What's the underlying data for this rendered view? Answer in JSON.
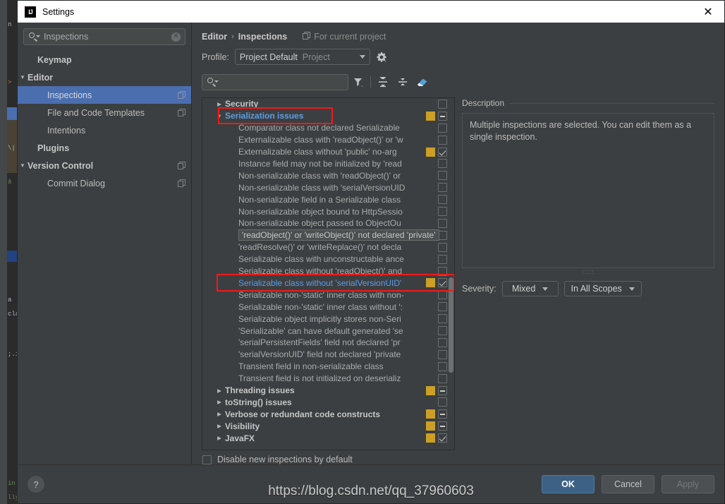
{
  "window": {
    "title": "Settings",
    "logo_text": "IJ",
    "close_icon": "close-icon"
  },
  "nav": {
    "search": {
      "value": "Inspections",
      "clear_icon": "clear-icon",
      "search_icon": "search-icon"
    },
    "items": [
      {
        "label": "Keymap",
        "bold": true,
        "arrow": "",
        "indent": 14,
        "selected": false,
        "copy": false
      },
      {
        "label": "Editor",
        "bold": true,
        "arrow": "▼",
        "indent": 0,
        "selected": false,
        "copy": false
      },
      {
        "label": "Inspections",
        "bold": false,
        "arrow": "",
        "indent": 28,
        "selected": true,
        "copy": true
      },
      {
        "label": "File and Code Templates",
        "bold": false,
        "arrow": "",
        "indent": 28,
        "selected": false,
        "copy": true
      },
      {
        "label": "Intentions",
        "bold": false,
        "arrow": "",
        "indent": 28,
        "selected": false,
        "copy": false
      },
      {
        "label": "Plugins",
        "bold": true,
        "arrow": "",
        "indent": 14,
        "selected": false,
        "copy": false
      },
      {
        "label": "Version Control",
        "bold": true,
        "arrow": "▼",
        "indent": 0,
        "selected": false,
        "copy": true
      },
      {
        "label": "Commit Dialog",
        "bold": false,
        "arrow": "",
        "indent": 28,
        "selected": false,
        "copy": true
      }
    ]
  },
  "header": {
    "breadcrumb_parent": "Editor",
    "breadcrumb_sep": "›",
    "breadcrumb_current": "Inspections",
    "for_current_project": "For current project",
    "profile_label": "Profile:",
    "profile_value": "Project Default",
    "profile_scope": "Project",
    "gear_icon": "gear-icon"
  },
  "toolbar": {
    "filter_placeholder": "",
    "filter_value": "",
    "filter_icon": "filter-funnel-icon",
    "expand_all_icon": "expand-all-icon",
    "collapse_all_icon": "collapse-all-icon",
    "reset_icon": "eraser-reset-icon"
  },
  "tree": {
    "rows": [
      {
        "label": "Security",
        "type": "group",
        "arrow": "▶",
        "sev": false,
        "check": "none"
      },
      {
        "label": "Serialization issues",
        "type": "group",
        "arrow": "▼",
        "sev": true,
        "check": "partial",
        "highlighted": true,
        "expanded_selected": true
      },
      {
        "label": "Comparator class not declared Serializable",
        "type": "leaf",
        "sev": false,
        "check": "none"
      },
      {
        "label": "Externalizable class with 'readObject()' or 'w",
        "type": "leaf",
        "sev": false,
        "check": "none"
      },
      {
        "label": "Externalizable class without 'public' no-arg ",
        "type": "leaf",
        "sev": true,
        "check": "checked"
      },
      {
        "label": "Instance field may not be initialized by 'read",
        "type": "leaf",
        "sev": false,
        "check": "none"
      },
      {
        "label": "Non-serializable class with 'readObject()' or ",
        "type": "leaf",
        "sev": false,
        "check": "none"
      },
      {
        "label": "Non-serializable class with 'serialVersionUID",
        "type": "leaf",
        "sev": false,
        "check": "none"
      },
      {
        "label": "Non-serializable field in a Serializable class",
        "type": "leaf",
        "sev": false,
        "check": "none"
      },
      {
        "label": "Non-serializable object bound to HttpSessio",
        "type": "leaf",
        "sev": false,
        "check": "none"
      },
      {
        "label": "Non-serializable object passed to ObjectOu",
        "type": "leaf",
        "sev": false,
        "check": "none"
      },
      {
        "label": "'readObject()' or 'writeObject()' not declared 'private'",
        "type": "leaf",
        "sev": false,
        "check": "none",
        "tooltip": true
      },
      {
        "label": "'readResolve()' or 'writeReplace()' not decla",
        "type": "leaf",
        "sev": false,
        "check": "none"
      },
      {
        "label": "Serializable class with unconstructable ance",
        "type": "leaf",
        "sev": false,
        "check": "none"
      },
      {
        "label": "Serializable class without 'readObject()' and ",
        "type": "leaf",
        "sev": false,
        "check": "none"
      },
      {
        "label": "Serializable class without 'serialVersionUID'",
        "type": "leaf",
        "sev": true,
        "check": "checked",
        "selected": true,
        "highlighted": true
      },
      {
        "label": "Serializable non-'static' inner class with non-",
        "type": "leaf",
        "sev": false,
        "check": "none"
      },
      {
        "label": "Serializable non-'static' inner class without ':",
        "type": "leaf",
        "sev": false,
        "check": "none"
      },
      {
        "label": "Serializable object implicitly stores non-Seri",
        "type": "leaf",
        "sev": false,
        "check": "none"
      },
      {
        "label": "'Serializable' can have default generated 'se",
        "type": "leaf",
        "sev": false,
        "check": "none"
      },
      {
        "label": "'serialPersistentFields' field not declared 'pr",
        "type": "leaf",
        "sev": false,
        "check": "none"
      },
      {
        "label": "'serialVersionUID' field not declared 'private",
        "type": "leaf",
        "sev": false,
        "check": "none"
      },
      {
        "label": "Transient field in non-serializable class",
        "type": "leaf",
        "sev": false,
        "check": "none"
      },
      {
        "label": "Transient field is not initialized on deserializ",
        "type": "leaf",
        "sev": false,
        "check": "none"
      },
      {
        "label": "Threading issues",
        "type": "group",
        "arrow": "▶",
        "sev": true,
        "check": "partial"
      },
      {
        "label": "toString() issues",
        "type": "group",
        "arrow": "▶",
        "sev": false,
        "check": "none"
      },
      {
        "label": "Verbose or redundant code constructs",
        "type": "group",
        "arrow": "▶",
        "sev": true,
        "check": "partial"
      },
      {
        "label": "Visibility",
        "type": "group",
        "arrow": "▶",
        "sev": true,
        "check": "partial"
      },
      {
        "label": "JavaFX",
        "type": "group",
        "arrow": "▶",
        "sev": true,
        "check": "checked"
      }
    ]
  },
  "description": {
    "legend": "Description",
    "text": "Multiple inspections are selected. You can edit them as a single inspection.",
    "grip": ":::::"
  },
  "severity": {
    "label": "Severity:",
    "value": "Mixed",
    "scope": "In All Scopes"
  },
  "footer": {
    "disable_new_label": "Disable new inspections by default",
    "help_label": "?",
    "ok_label": "OK",
    "cancel_label": "Cancel",
    "apply_label": "Apply"
  },
  "watermark": {
    "text": "https://blog.csdn.net/qq_37960603"
  },
  "colors": {
    "selection_blue": "#4b6eaf",
    "link_blue": "#5f9de4",
    "severity_yellow": "#cc9f27",
    "highlight_red": "#f01a1a",
    "panel_bg": "#3c3f41"
  }
}
